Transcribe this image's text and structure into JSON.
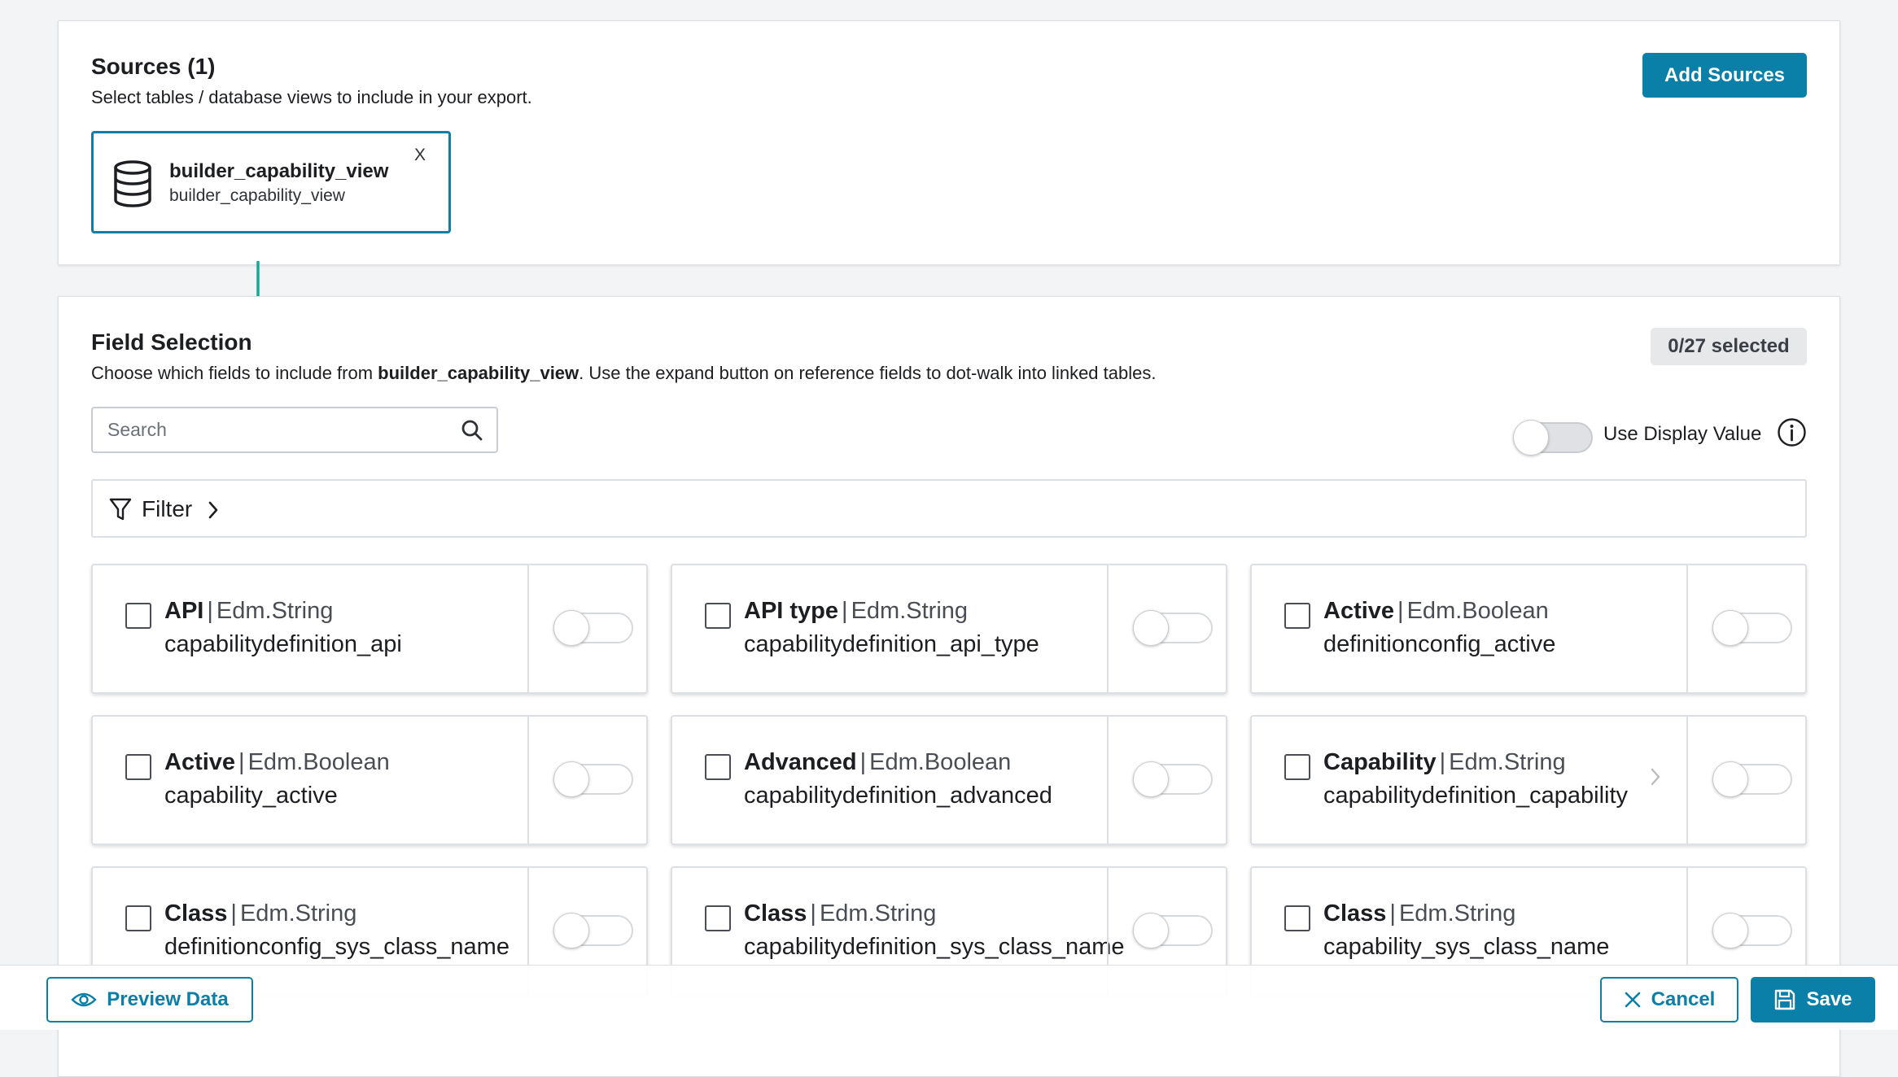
{
  "sources": {
    "title": "Sources (1)",
    "subtitle": "Select tables / database views to include in your export.",
    "add_label": "Add Sources",
    "items": [
      {
        "name": "builder_capability_view",
        "subname": "builder_capability_view",
        "close": "X",
        "icon": "database-icon"
      }
    ]
  },
  "field_selection": {
    "title": "Field Selection",
    "subtitle_pre": "Choose which fields to include from ",
    "subtitle_table": "builder_capability_view",
    "subtitle_post": ". Use the expand button on reference fields to dot-walk into linked tables.",
    "count": "0/27 selected",
    "search_placeholder": "Search",
    "use_display_label": "Use Display Value",
    "use_display_on": false,
    "filter_label": "Filter",
    "fields": [
      {
        "name": "API",
        "type": "Edm.String",
        "path": "capabilitydefinition_api",
        "checked": false,
        "toggle": false,
        "expandable": false
      },
      {
        "name": "API type",
        "type": "Edm.String",
        "path": "capabilitydefinition_api_type",
        "checked": false,
        "toggle": false,
        "expandable": false
      },
      {
        "name": "Active",
        "type": "Edm.Boolean",
        "path": "definitionconfig_active",
        "checked": false,
        "toggle": false,
        "expandable": false
      },
      {
        "name": "Active",
        "type": "Edm.Boolean",
        "path": "capability_active",
        "checked": false,
        "toggle": false,
        "expandable": false
      },
      {
        "name": "Advanced",
        "type": "Edm.Boolean",
        "path": "capabilitydefinition_advanced",
        "checked": false,
        "toggle": false,
        "expandable": false
      },
      {
        "name": "Capability",
        "type": "Edm.String",
        "path": "capabilitydefinition_capability",
        "checked": false,
        "toggle": false,
        "expandable": true
      },
      {
        "name": "Class",
        "type": "Edm.String",
        "path": "definitionconfig_sys_class_name",
        "checked": false,
        "toggle": false,
        "expandable": false
      },
      {
        "name": "Class",
        "type": "Edm.String",
        "path": "capabilitydefinition_sys_class_name",
        "checked": false,
        "toggle": false,
        "expandable": false
      },
      {
        "name": "Class",
        "type": "Edm.String",
        "path": "capability_sys_class_name",
        "checked": false,
        "toggle": false,
        "expandable": false
      }
    ]
  },
  "footer": {
    "preview_label": "Preview Data",
    "cancel_label": "Cancel",
    "save_label": "Save"
  },
  "colors": {
    "accent": "#0a7fa8",
    "connector": "#12a99a"
  }
}
